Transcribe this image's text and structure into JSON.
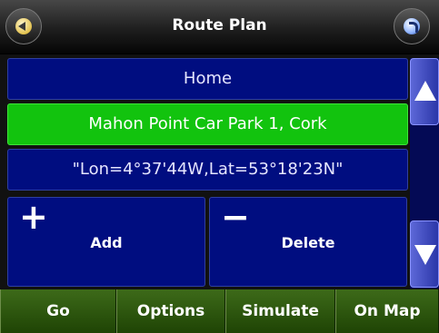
{
  "header": {
    "title": "Route Plan",
    "back_icon": "back-arrow-icon",
    "help_icon": "help-icon"
  },
  "route": {
    "items": [
      {
        "label": "Home",
        "selected": false
      },
      {
        "label": "Mahon Point Car Park 1, Cork",
        "selected": true
      },
      {
        "label": "\"Lon=4°37'44W,Lat=53°18'23N\"",
        "selected": false
      }
    ]
  },
  "actions": {
    "add": {
      "icon": "+",
      "label": "Add"
    },
    "delete": {
      "icon": "−",
      "label": "Delete"
    }
  },
  "scroll": {
    "up_icon": "scroll-up-arrow-icon",
    "down_icon": "scroll-down-arrow-icon"
  },
  "toolbar": {
    "go": "Go",
    "options": "Options",
    "simulate": "Simulate",
    "on_map": "On Map"
  },
  "colors": {
    "list_bg": "#000d80",
    "selected_bg": "#12c30e",
    "toolbar_bg": "#2f5a10"
  }
}
